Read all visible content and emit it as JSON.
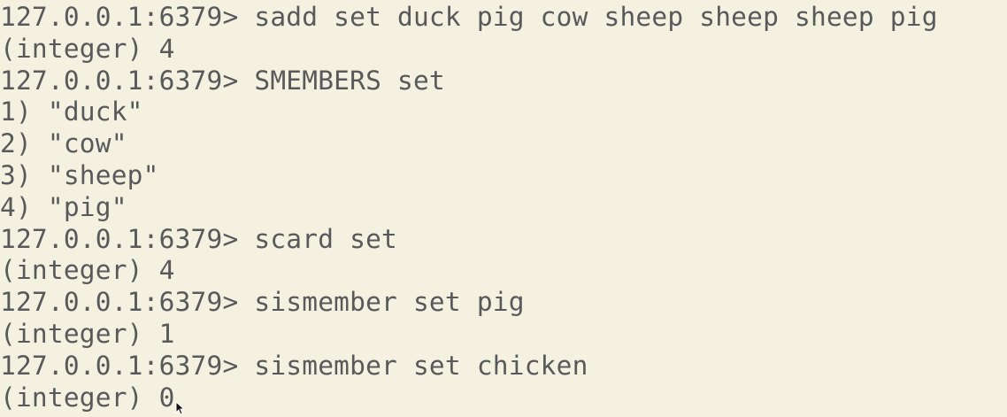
{
  "terminal": {
    "lines": [
      {
        "text": "127.0.0.1:6379> sadd set duck pig cow sheep sheep sheep pig",
        "kind": "command"
      },
      {
        "text": "(integer) 4",
        "kind": "output"
      },
      {
        "text": "127.0.0.1:6379> SMEMBERS set",
        "kind": "command"
      },
      {
        "text": "1) \"duck\"",
        "kind": "output"
      },
      {
        "text": "2) \"cow\"",
        "kind": "output"
      },
      {
        "text": "3) \"sheep\"",
        "kind": "output"
      },
      {
        "text": "4) \"pig\"",
        "kind": "output"
      },
      {
        "text": "127.0.0.1:6379> scard set",
        "kind": "command"
      },
      {
        "text": "(integer) 4",
        "kind": "output"
      },
      {
        "text": "127.0.0.1:6379> sismember set pig",
        "kind": "command"
      },
      {
        "text": "(integer) 1",
        "kind": "output"
      },
      {
        "text": "127.0.0.1:6379> sismember set chicken",
        "kind": "command"
      },
      {
        "text": "(integer) 0",
        "kind": "output"
      }
    ],
    "colors": {
      "background": "#f5f1e1",
      "text": "#57595b"
    },
    "cursor_icon": "mouse-pointer-icon"
  }
}
